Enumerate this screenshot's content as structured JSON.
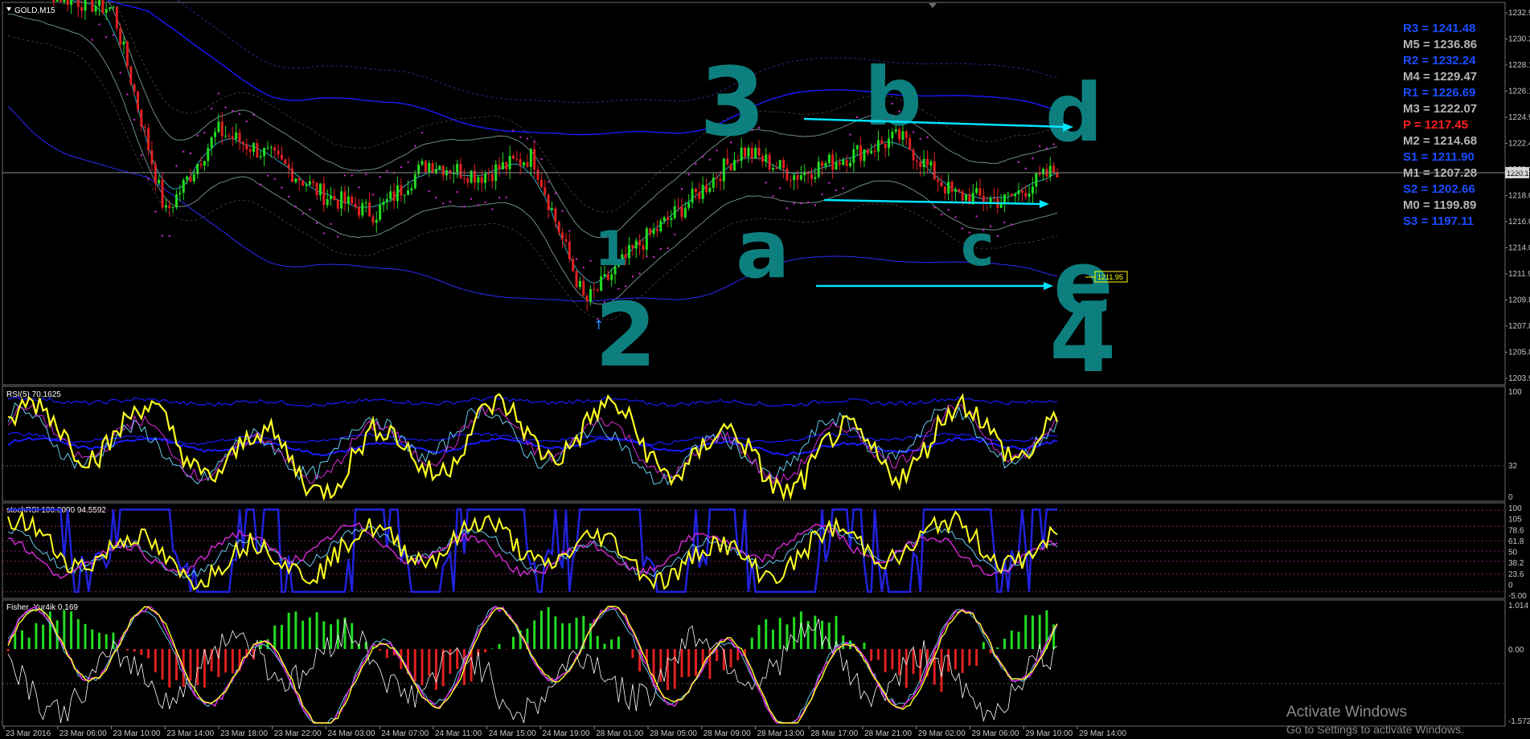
{
  "main_pane": {
    "title": "GOLD,M15",
    "price_ticks": [
      "1232.9",
      "1230.2",
      "1228.1",
      "1226.1",
      "1224.9",
      "1222.4",
      "1220.1",
      "1218.0",
      "1216.0",
      "1214.0",
      "1211.9",
      "1209.8",
      "1207.8",
      "1205.8",
      "1203.9"
    ],
    "current_price_tag": "1220.1",
    "price_box_label": "1211.95",
    "arrow_glyph": "↑"
  },
  "pivots": [
    {
      "label": "R3 = 1241.48",
      "color": "#1a4dff"
    },
    {
      "label": "M5 = 1236.86",
      "color": "#b4b4b4"
    },
    {
      "label": "R2 = 1232.24",
      "color": "#1a4dff"
    },
    {
      "label": "M4 = 1229.47",
      "color": "#b4b4b4"
    },
    {
      "label": "R1 = 1226.69",
      "color": "#1a4dff"
    },
    {
      "label": "M3 = 1222.07",
      "color": "#b4b4b4"
    },
    {
      "label": "P  = 1217.45",
      "color": "#ff2020"
    },
    {
      "label": "M2 = 1214.68",
      "color": "#b4b4b4"
    },
    {
      "label": "S1 = 1211.90",
      "color": "#1a4dff"
    },
    {
      "label": "M1 = 1207.28",
      "color": "#b4b4b4"
    },
    {
      "label": "S2 = 1202.66",
      "color": "#1a4dff"
    },
    {
      "label": "M0 = 1199.89",
      "color": "#b4b4b4"
    },
    {
      "label": "S3 = 1197.11",
      "color": "#1a4dff"
    }
  ],
  "annotations": {
    "labels": [
      "3",
      "b",
      "d",
      "1",
      "a",
      "c",
      "e",
      "2",
      "4"
    ]
  },
  "rsi_pane": {
    "title": "RSI(5) 70.1625",
    "ticks": [
      "100",
      "32",
      "0"
    ]
  },
  "stoch_pane": {
    "title": "stochRSI 100.0000 94.5592",
    "ticks": [
      "100",
      "105",
      "78.6",
      "61.8",
      "50",
      "38.2",
      "23.6",
      "0",
      "-5.00"
    ]
  },
  "fisher_pane": {
    "title": "Fisher_Yur4ik 0.169",
    "ticks": [
      "1.014",
      "0.00",
      "-1.572"
    ]
  },
  "time_axis": [
    "23 Mar 2016",
    "23 Mar 06:00",
    "23 Mar 10:00",
    "23 Mar 14:00",
    "23 Mar 18:00",
    "23 Mar 22:00",
    "24 Mar 03:00",
    "24 Mar 07:00",
    "24 Mar 11:00",
    "24 Mar 15:00",
    "24 Mar 19:00",
    "28 Mar 01:00",
    "28 Mar 05:00",
    "28 Mar 09:00",
    "28 Mar 13:00",
    "28 Mar 17:00",
    "28 Mar 21:00",
    "29 Mar 02:00",
    "29 Mar 06:00",
    "29 Mar 10:00",
    "29 Mar 14:00"
  ],
  "watermark": {
    "line1": "Activate Windows",
    "line2": "Go to Settings to activate Windows."
  },
  "colors": {
    "bull": "#22dd22",
    "bear": "#e02020",
    "rsi": "#ffff22",
    "band": "#1a1aff",
    "handwriting": "#0e7f7f",
    "arrow": "#00e5ff"
  },
  "chart_data": {
    "type": "line",
    "title": "GOLD,M15",
    "x": [
      "23 Mar 2016",
      "23 Mar 06:00",
      "23 Mar 10:00",
      "23 Mar 14:00",
      "23 Mar 18:00",
      "23 Mar 22:00",
      "24 Mar 03:00",
      "24 Mar 07:00",
      "24 Mar 11:00",
      "24 Mar 15:00",
      "24 Mar 19:00",
      "28 Mar 01:00",
      "28 Mar 05:00",
      "28 Mar 09:00",
      "28 Mar 13:00",
      "28 Mar 17:00",
      "28 Mar 21:00",
      "29 Mar 02:00",
      "29 Mar 06:00",
      "29 Mar 10:00",
      "29 Mar 14:00"
    ],
    "series": [
      {
        "name": "GOLD,M15",
        "values": [
          1236.0,
          1234.0,
          1233.0,
          1217.0,
          1223.5,
          1221.5,
          1218.5,
          1217.0,
          1221.0,
          1220.0,
          1221.5,
          1210.0,
          1214.5,
          1218.0,
          1222.0,
          1220.0,
          1221.5,
          1223.0,
          1218.5,
          1218.0,
          1220.5
        ]
      }
    ],
    "ylim": [
      1203.9,
      1233.2
    ]
  }
}
